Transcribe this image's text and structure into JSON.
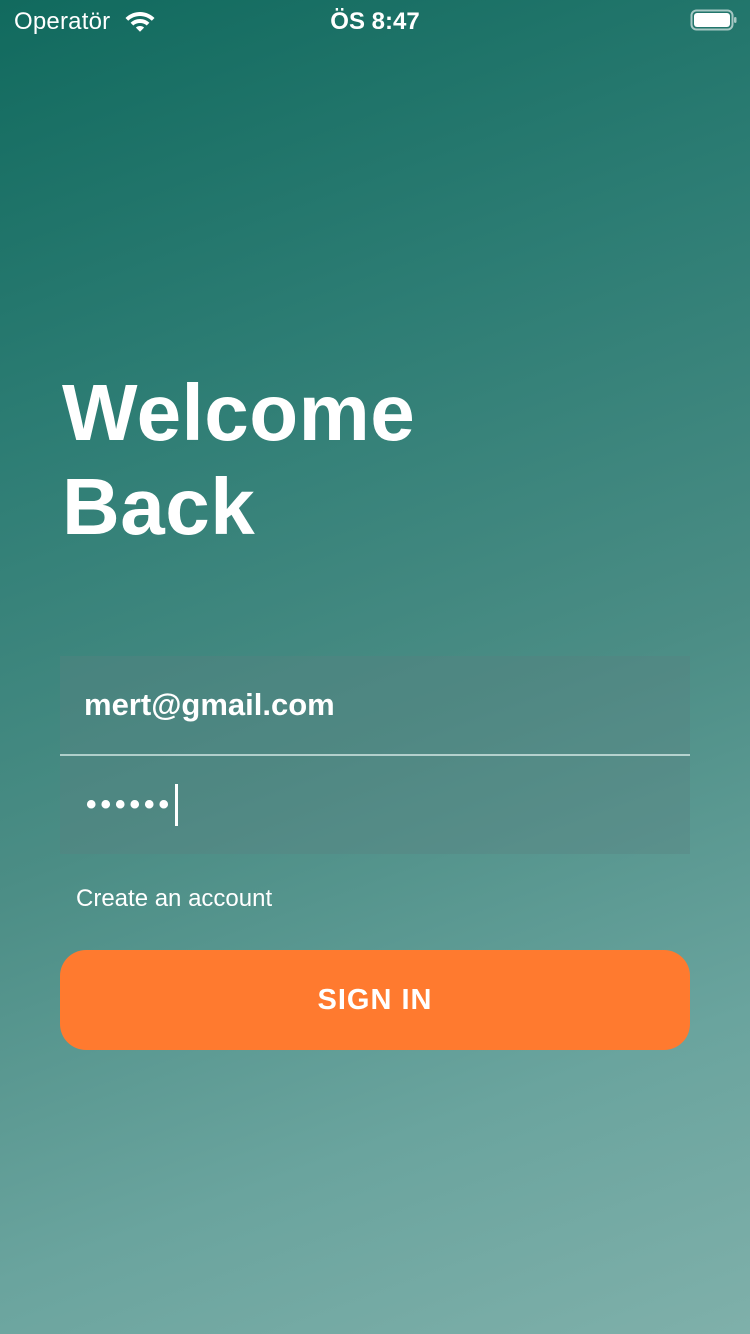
{
  "status_bar": {
    "carrier": "Operatör",
    "time": "ÖS 8:47",
    "wifi_icon": "wifi-icon",
    "battery_icon": "battery-full-icon"
  },
  "heading": {
    "line1": "Welcome",
    "line2": "Back"
  },
  "form": {
    "email_value": "mert@gmail.com",
    "password_masked": "••••••"
  },
  "links": {
    "create_account": "Create an account"
  },
  "buttons": {
    "sign_in": "SIGN IN"
  },
  "colors": {
    "background_top": "#116a5e",
    "background_bottom": "#7fb0aa",
    "accent_button": "#ff7a2f",
    "text": "#ffffff"
  }
}
